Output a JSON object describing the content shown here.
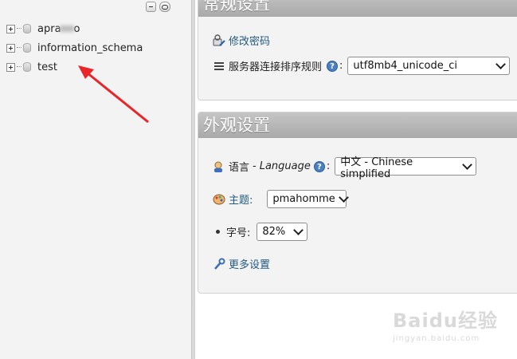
{
  "navigation": {
    "databases": [
      {
        "name": "apramo",
        "name_partially_hidden": true
      },
      {
        "name": "information_schema"
      },
      {
        "name": "test"
      }
    ]
  },
  "general_settings": {
    "title": "常规设置",
    "change_password_link": "修改密码",
    "collation_label": "服务器连接排序规则",
    "collation_value": "utf8mb4_unicode_ci"
  },
  "appearance_settings": {
    "title": "外观设置",
    "language_label": "语言",
    "language_separator": "-",
    "language_label_en": "Language",
    "language_value": "中文 - Chinese simplified",
    "theme_label": "主题:",
    "theme_value": "pmahomme",
    "font_size_label": "字号:",
    "font_size_value": "82%",
    "more_settings_link": "更多设置"
  },
  "watermark": {
    "line1": "Baidu经验",
    "line2": "jingyan.baidu.com"
  },
  "colors": {
    "annotation_arrow": "#e8262a",
    "link": "#235a81",
    "panel_header": "#b3b3b3"
  }
}
